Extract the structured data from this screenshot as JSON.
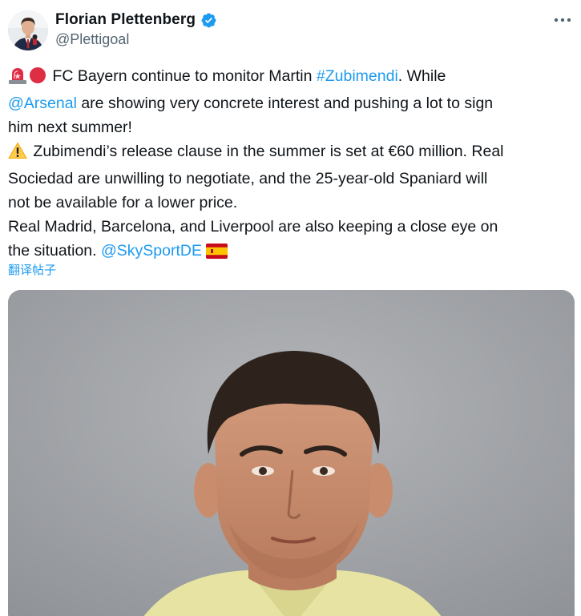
{
  "author": {
    "display_name": "Florian Plettenberg",
    "handle": "@Plettigoal",
    "verified": true
  },
  "icons": {
    "verified": "verified-badge-icon",
    "more": "more-horizontal-icon",
    "siren": "police-light-emoji",
    "red_circle": "red-circle-emoji",
    "warning": "warning-emoji",
    "flag": "spain-flag-emoji"
  },
  "tweet": {
    "line1_text_a": " FC Bayern continue to monitor Martin ",
    "hashtag": "#Zubimendi",
    "line1_text_b": ". While",
    "mention_arsenal": "@Arsenal",
    "line2_text": " are showing very concrete interest and pushing a lot to sign",
    "line3_text": "him next summer!",
    "line4_text": " Zubimendi’s release clause in the summer is set at €60 million. Real",
    "line5_text": "Sociedad are unwilling to negotiate, and the 25-year-old Spaniard will",
    "line6_text": "not be available for a lower price.",
    "line7_text": "Real Madrid, Barcelona, and Liverpool are also keeping a close eye on",
    "line8_text": "the situation. ",
    "mention_sky": "@SkySportDE"
  },
  "translate_label": "翻译帖子",
  "colors": {
    "link": "#1d9bf0",
    "text": "#0f1419",
    "secondary": "#536471",
    "verified": "#1d9bf0"
  }
}
